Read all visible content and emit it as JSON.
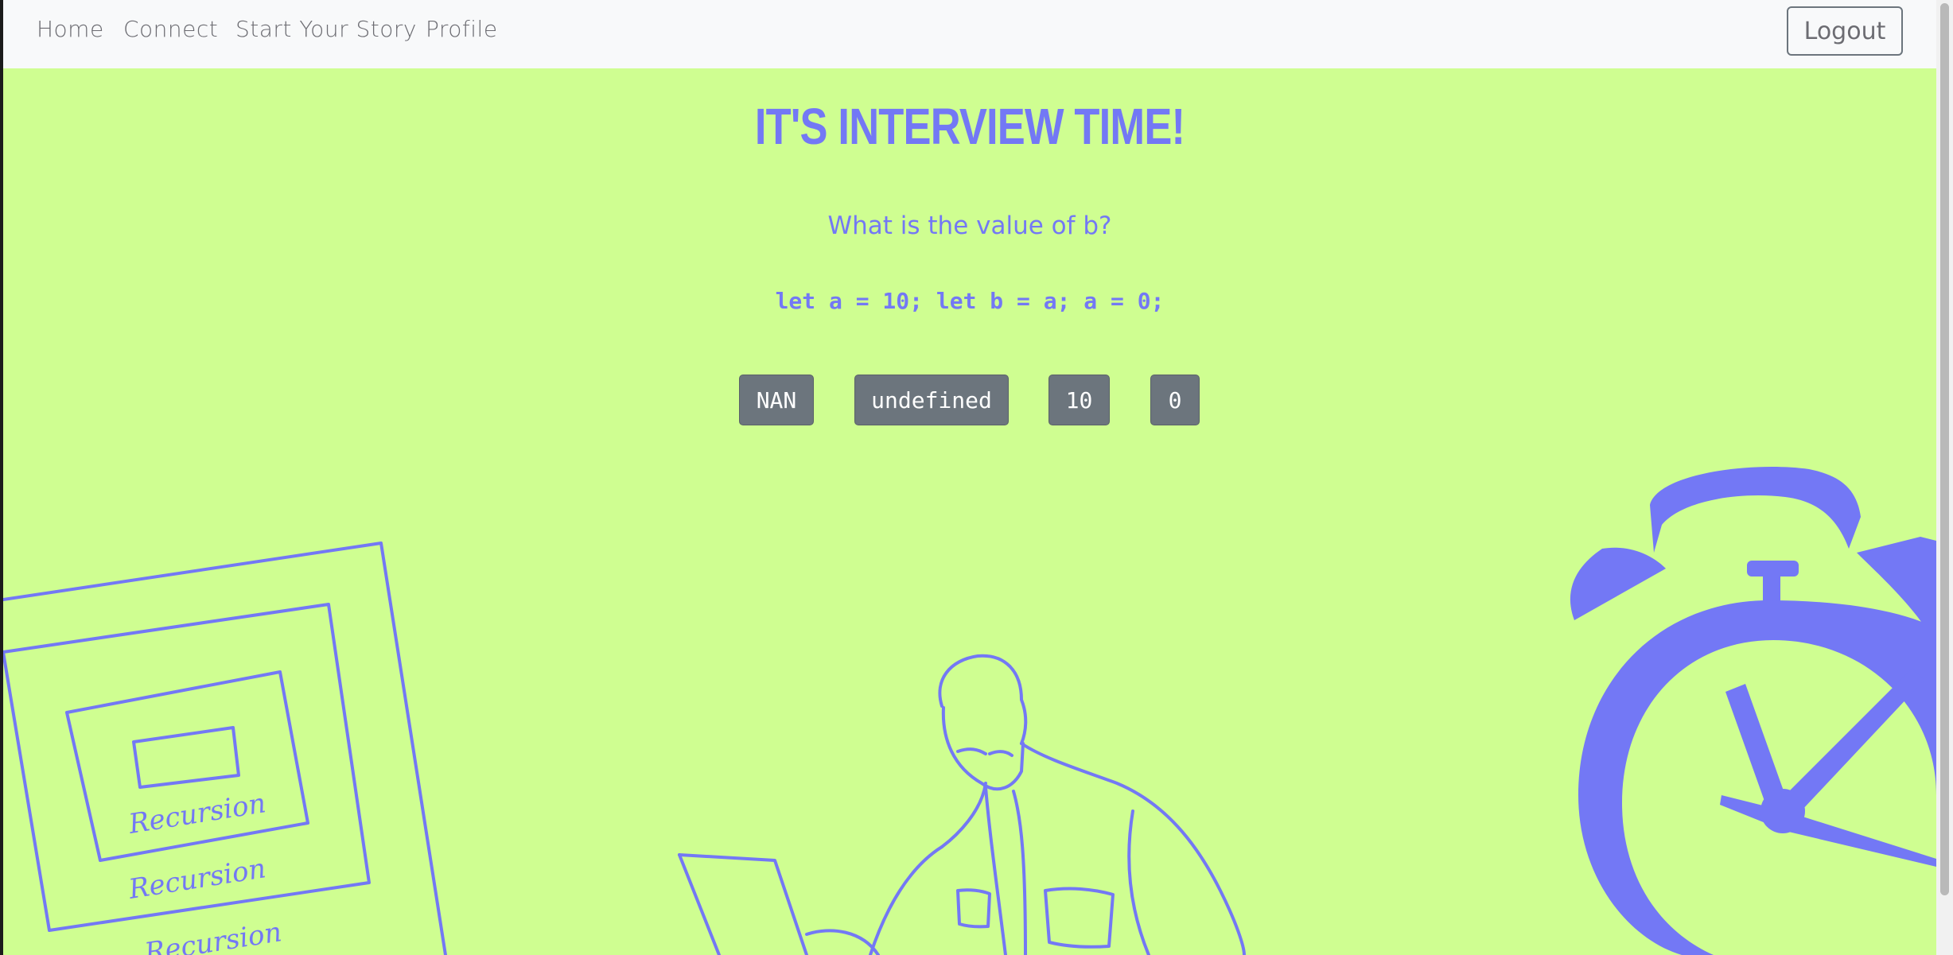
{
  "nav": {
    "links": [
      "Home",
      "Connect",
      "Start Your Story",
      "Profile"
    ],
    "logout_label": "Logout"
  },
  "main": {
    "title": "It's Interview Time!",
    "question": "What is the value of b?",
    "code": "let a = 10; let b = a; a = 0;",
    "answers": [
      "NAN",
      "undefined",
      "10",
      "0"
    ]
  },
  "illustration": {
    "recursion_text": [
      "Recursion",
      "Recursion",
      "Recursion"
    ]
  },
  "colors": {
    "background": "#cffe91",
    "accent": "#7378f5",
    "button": "#6c757d",
    "navbar": "#f8f9fa"
  }
}
